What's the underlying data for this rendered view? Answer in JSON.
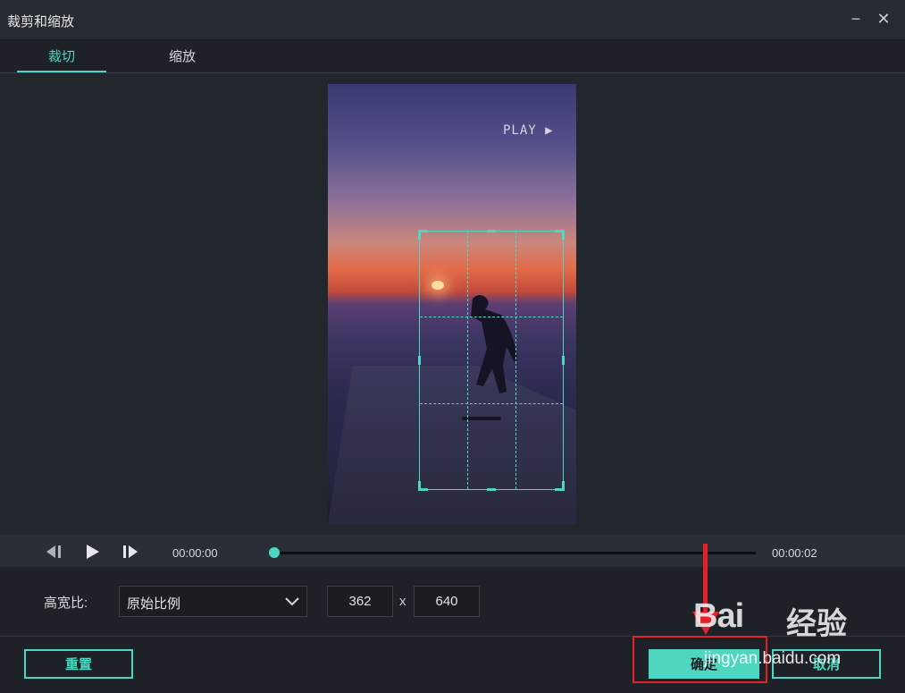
{
  "window": {
    "title": "裁剪和缩放",
    "minimize_glyph": "−",
    "close_glyph": "✕"
  },
  "tabs": [
    {
      "label": "裁切",
      "active": true
    },
    {
      "label": "缩放",
      "active": false
    }
  ],
  "preview": {
    "overlay_text": "PLAY ▶"
  },
  "playback": {
    "current_time": "00:00:00",
    "end_time": "00:00:02",
    "progress": 0.0
  },
  "aspect": {
    "label": "高宽比:",
    "selected": "原始比例",
    "width": "362",
    "separator": "x",
    "height": "640"
  },
  "buttons": {
    "reset": "重置",
    "confirm": "确定",
    "cancel": "取消"
  },
  "watermark": {
    "brand": "Bai",
    "brand2": "经验",
    "url": "jingyan.baidu.com"
  },
  "colors": {
    "accent": "#4fd6c0",
    "annotation": "#e3212b",
    "background": "#1e2228"
  }
}
